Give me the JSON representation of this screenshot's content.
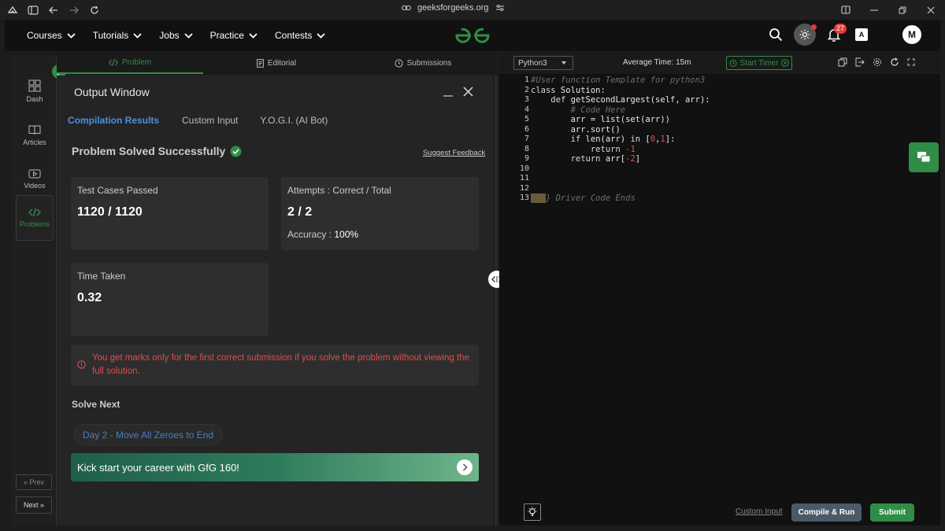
{
  "browser": {
    "url": "geeksforgeeks.org"
  },
  "nav": {
    "items": [
      {
        "label": "Courses"
      },
      {
        "label": "Tutorials"
      },
      {
        "label": "Jobs"
      },
      {
        "label": "Practice"
      },
      {
        "label": "Contests"
      }
    ],
    "notification_count": "27",
    "avatar_initial": "M",
    "translate_label": "A"
  },
  "sidebar": {
    "items": [
      {
        "label": "Dash"
      },
      {
        "label": "Articles"
      },
      {
        "label": "Videos"
      },
      {
        "label": "Problems"
      }
    ],
    "prev_label": "« Prev",
    "next_label": "Next »"
  },
  "problem_tabs": [
    {
      "label": "Problem"
    },
    {
      "label": "Editorial"
    },
    {
      "label": "Submissions"
    }
  ],
  "output": {
    "title": "Output Window",
    "tabs": [
      {
        "label": "Compilation Results"
      },
      {
        "label": "Custom Input"
      },
      {
        "label": "Y.O.G.I. (AI Bot)"
      }
    ],
    "status": "Problem Solved Successfully",
    "feedback": "Suggest Feedback",
    "tests_label": "Test Cases Passed",
    "tests_value": "1120 / 1120",
    "attempts_label": "Attempts : Correct / Total",
    "attempts_value": "2 / 2",
    "accuracy_label": "Accuracy :",
    "accuracy_value": "100%",
    "time_label": "Time Taken",
    "time_value": "0.32",
    "warning": "You get marks only for the first correct submission if you solve the problem without viewing the full solution.",
    "solve_next": "Solve Next",
    "next_problem": "Day 2 - Move All Zeroes to End",
    "banner": "Kick start your career with GfG 160!"
  },
  "editor": {
    "language": "Python3",
    "avg_time": "Average Time: 15m",
    "timer": "Start Timer",
    "line_numbers": [
      "1",
      "2",
      "3",
      "4",
      "5",
      "6",
      "7",
      "8",
      "9",
      "10",
      "11",
      "12",
      "13"
    ],
    "custom_input": "Custom Input",
    "compile_run": "Compile & Run",
    "submit": "Submit"
  },
  "colors": {
    "accent": "#2f8d46",
    "link": "#4a90e2",
    "error": "#e24b4b"
  }
}
